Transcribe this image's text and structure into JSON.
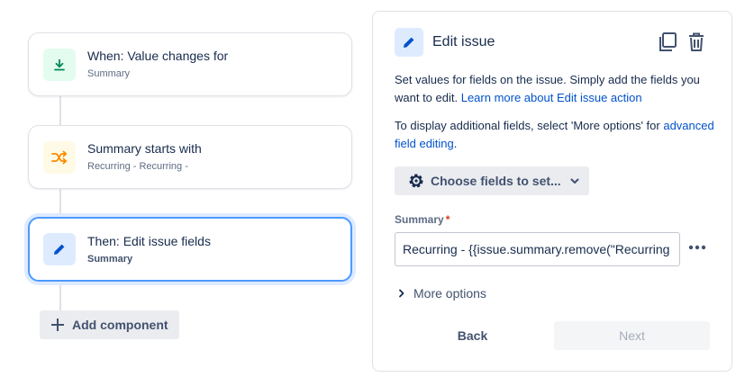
{
  "flow": {
    "cards": [
      {
        "title": "When: Value changes for",
        "subtitle": "Summary",
        "icon": "trigger-download-icon"
      },
      {
        "title": "Summary starts with",
        "subtitle": "Recurring - Recurring -",
        "icon": "shuffle-condition-icon"
      },
      {
        "title": "Then: Edit issue fields",
        "subtitle": "Summary",
        "icon": "pencil-icon"
      }
    ],
    "add_component_label": "Add component"
  },
  "panel": {
    "title": "Edit issue",
    "description_prefix": "Set values for fields on the issue. Simply add the fields you want to edit. ",
    "learn_more_link": "Learn more about Edit issue action",
    "display_prefix": "To display additional fields, select 'More options' for ",
    "advanced_link": "advanced field editing",
    "display_suffix": ".",
    "choose_fields_label": "Choose fields to set...",
    "field": {
      "label": "Summary",
      "required_marker": "*",
      "value": "Recurring - {{issue.summary.remove(\"Recurring - Recurring -\")}}"
    },
    "more_options_label": "More options",
    "back_label": "Back",
    "next_label": "Next"
  },
  "colors": {
    "trigger_bg": "#e3fcef",
    "trigger_fg": "#00875a",
    "condition_bg": "#fffae6",
    "condition_fg": "#ff8b00",
    "action_bg": "#deebff",
    "action_fg": "#0052cc",
    "link": "#0052cc",
    "selected_border": "#4c9aff"
  }
}
